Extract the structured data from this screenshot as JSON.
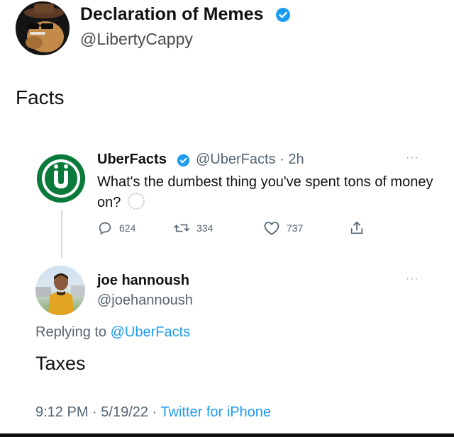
{
  "header": {
    "name": "Declaration of Memes",
    "handle": "@LibertyCappy",
    "verified_icon": "verified-badge-icon"
  },
  "caption": "Facts",
  "quoted_tweet": {
    "name": "UberFacts",
    "handle": "@UberFacts",
    "separator": "·",
    "time": "2h",
    "text": "What's the dumbest thing you've spent tons of money on?",
    "more": "···",
    "stats": {
      "replies": "624",
      "retweets": "334",
      "likes": "737"
    }
  },
  "reply_tweet": {
    "name": "joe hannoush",
    "handle": "@joehannoush",
    "more": "···",
    "replying_prefix": "Replying to",
    "replying_to": "@UberFacts",
    "text": "Taxes",
    "time": "9:12 PM",
    "date": "5/19/22",
    "source": "Twitter for iPhone"
  },
  "colors": {
    "accent": "#1d9bf0",
    "muted": "#536471",
    "uberfacts_green": "#0a7a3a"
  }
}
